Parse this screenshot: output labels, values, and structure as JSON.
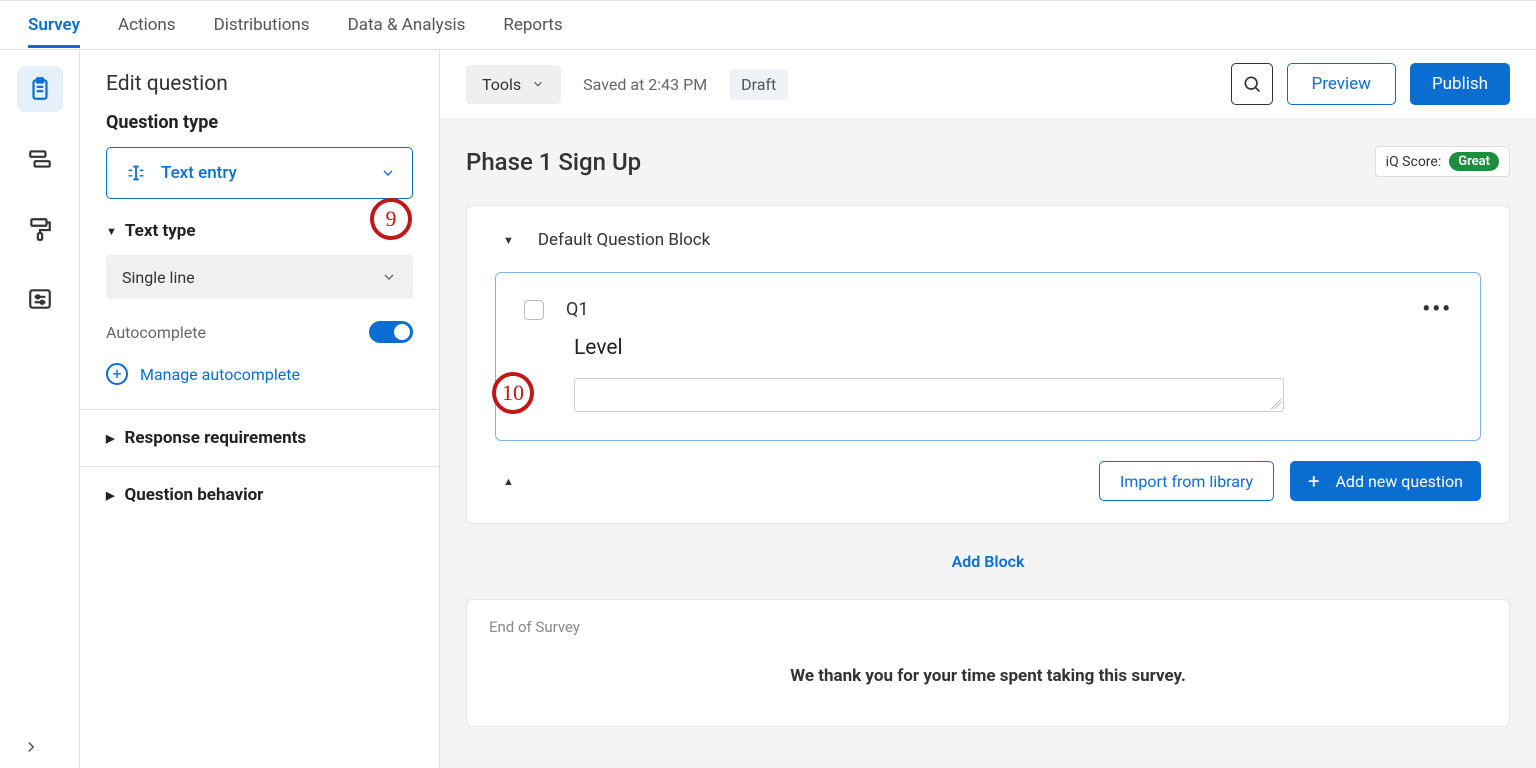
{
  "topNav": {
    "items": [
      "Survey",
      "Actions",
      "Distributions",
      "Data & Analysis",
      "Reports"
    ],
    "activeIndex": 0
  },
  "editPanel": {
    "title": "Edit question",
    "questionTypeHeading": "Question type",
    "questionType": "Text entry",
    "textTypeHeading": "Text type",
    "textTypeValue": "Single line",
    "autocompleteLabel": "Autocomplete",
    "autocompleteOn": true,
    "manageAutocomplete": "Manage autocomplete",
    "responseReq": "Response requirements",
    "questionBehavior": "Question behavior"
  },
  "canvasHeader": {
    "tools": "Tools",
    "savedText": "Saved at 2:43 PM",
    "draft": "Draft",
    "preview": "Preview",
    "publish": "Publish"
  },
  "survey": {
    "title": "Phase 1 Sign Up",
    "iqLabel": "iQ Score:",
    "iqValue": "Great",
    "block": {
      "name": "Default Question Block",
      "question": {
        "number": "Q1",
        "label": "Level"
      },
      "importLib": "Import from library",
      "addNew": "Add new question"
    },
    "addBlock": "Add Block",
    "end": {
      "title": "End of Survey",
      "message": "We thank you for your time spent taking this survey."
    }
  },
  "annotations": {
    "a9": "9",
    "a10": "10"
  }
}
